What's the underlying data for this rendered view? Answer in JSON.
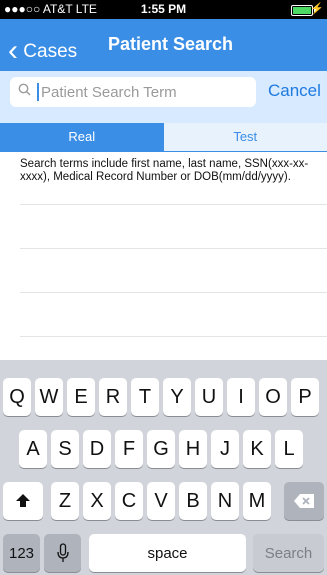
{
  "status": {
    "carrier": "●●●○○ AT&T  LTE",
    "time": "1:55 PM",
    "bolt": "⚡"
  },
  "nav": {
    "back_label": "Cases",
    "back_chevron": "‹",
    "title": "Patient Search"
  },
  "search": {
    "icon": "⌕",
    "placeholder": "Patient Search Term",
    "value": "",
    "cancel_label": "Cancel"
  },
  "segments": [
    {
      "label": "Real"
    },
    {
      "label": "Test"
    }
  ],
  "hint": "Search terms include first name, last name, SSN(xxx-xx-xxxx), Medical Record Number or DOB(mm/dd/yyyy).",
  "keyboard": {
    "row1": [
      "Q",
      "W",
      "E",
      "R",
      "T",
      "Y",
      "U",
      "I",
      "O",
      "P"
    ],
    "row2": [
      "A",
      "S",
      "D",
      "F",
      "G",
      "H",
      "J",
      "K",
      "L"
    ],
    "row3": [
      "Z",
      "X",
      "C",
      "V",
      "B",
      "N",
      "M"
    ],
    "shift_icon": "shift-icon",
    "delete_icon": "delete-icon",
    "numbers_label": "123",
    "mic_icon": "microphone-icon",
    "space_label": "space",
    "search_label": "Search"
  },
  "colors": {
    "accent": "#3a8ee6",
    "link": "#1f7ae0",
    "search_bg": "#d7eaff",
    "keyboard_bg": "#d1d4da"
  }
}
